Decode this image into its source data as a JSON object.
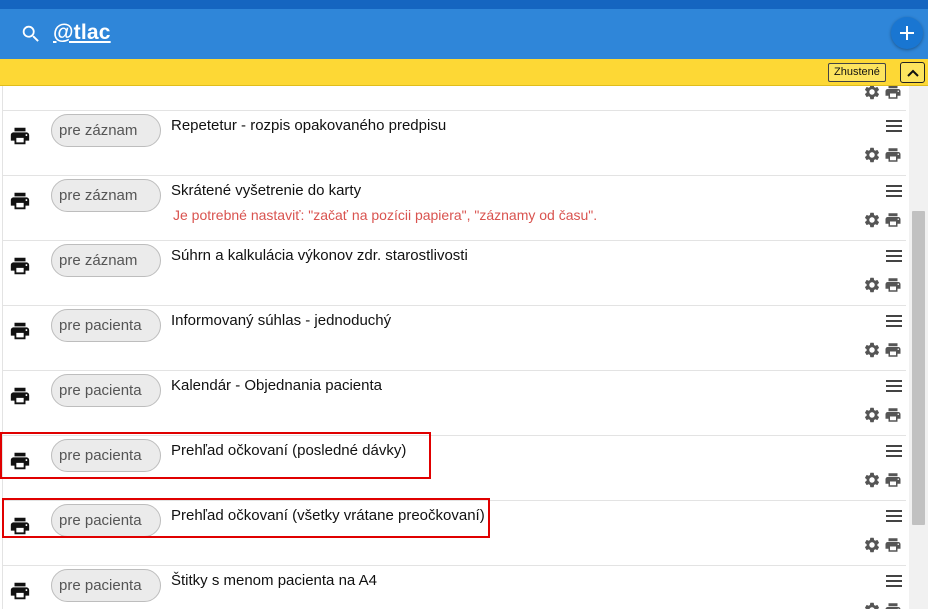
{
  "header": {
    "search_text": "@tlac",
    "add_button_label": "+"
  },
  "toolbar": {
    "dense_label": "Zhustené"
  },
  "rows": [
    {
      "type": "pre záznam",
      "title": "Repetetur - rozpis opakovaného predpisu",
      "warning": ""
    },
    {
      "type": "pre záznam",
      "title": "Skrátené vyšetrenie do karty",
      "warning": "Je potrebné nastaviť: \"začať na pozícii papiera\", \"záznamy od času\"."
    },
    {
      "type": "pre záznam",
      "title": "Súhrn a kalkulácia výkonov zdr. starostlivosti",
      "warning": ""
    },
    {
      "type": "pre pacienta",
      "title": "Informovaný súhlas - jednoduchý",
      "warning": ""
    },
    {
      "type": "pre pacienta",
      "title": "Kalendár - Objednania pacienta",
      "warning": ""
    },
    {
      "type": "pre pacienta",
      "title": "Prehľad očkovaní (posledné dávky)",
      "warning": ""
    },
    {
      "type": "pre pacienta",
      "title": "Prehľad očkovaní (všetky vrátane preočkovaní)",
      "warning": ""
    },
    {
      "type": "pre pacienta",
      "title": "Štitky s menom pacienta na A4",
      "warning": ""
    }
  ],
  "colors": {
    "header": "#2f86d9",
    "top_strip": "#1565c0",
    "toolbar": "#fdd835",
    "warning": "#d9534f",
    "highlight": "#e00000"
  }
}
